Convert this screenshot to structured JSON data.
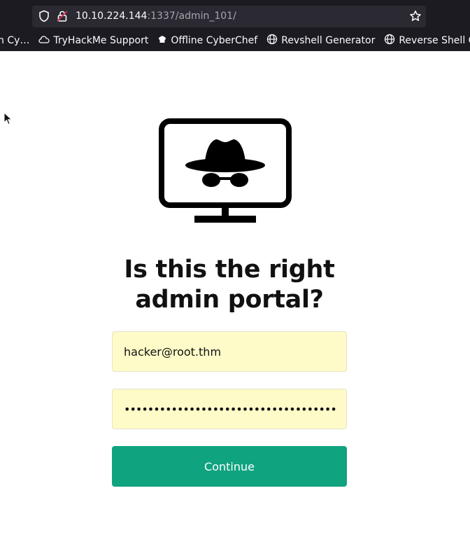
{
  "browser": {
    "url_host": "10.10.224.144",
    "url_rest": ":1337/admin_101/",
    "bookmarks": [
      {
        "label": "n Cy…",
        "icon": "globe-icon"
      },
      {
        "label": "TryHackMe Support",
        "icon": "cloud-icon"
      },
      {
        "label": "Offline CyberChef",
        "icon": "chef-hat-icon"
      },
      {
        "label": "Revshell Generator",
        "icon": "globe-icon"
      },
      {
        "label": "Reverse Shell Cheat",
        "icon": "globe-icon"
      }
    ]
  },
  "login": {
    "title_line1": "Is this the right",
    "title_line2": "admin portal?",
    "email_value": "hacker@root.thm",
    "password_masked": "••••••••••••••••••••••••••••••••••••",
    "continue_label": "Continue"
  },
  "colors": {
    "accent": "#10a37f",
    "autofill": "#fffbc8",
    "chrome": "#1c1b22"
  }
}
